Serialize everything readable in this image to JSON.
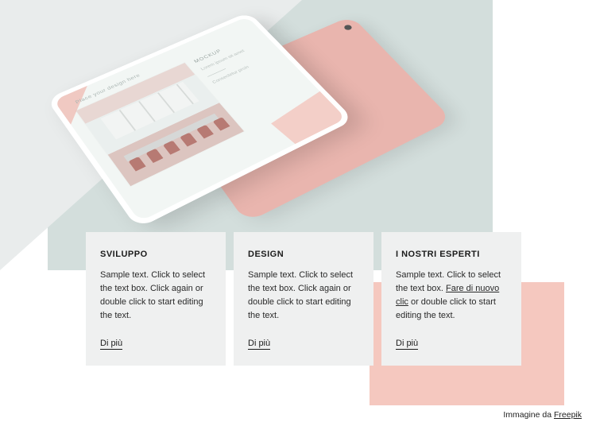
{
  "tablet": {
    "header_text": "Place your design here",
    "mockup_title": "MOCKUP",
    "mockup_lorem": "Lorem ipsum sit amet",
    "mockup_cta": "Consectetur proin"
  },
  "cards": [
    {
      "title": "SVILUPPO",
      "body": "Sample text. Click to select the text box. Click again or double click to start editing the text.",
      "more": "Di più"
    },
    {
      "title": "DESIGN",
      "body": "Sample text. Click to select the text box. Click again or double click to start editing the text.",
      "more": "Di più"
    },
    {
      "title": "I NOSTRI ESPERTI",
      "body_pre": "Sample text. Click to select the text box. ",
      "body_link": "Fare di nuovo clic",
      "body_post": " or double click to start editing the text.",
      "more": "Di più"
    }
  ],
  "credit": {
    "prefix": "Immagine da ",
    "link_text": "Freepik"
  }
}
